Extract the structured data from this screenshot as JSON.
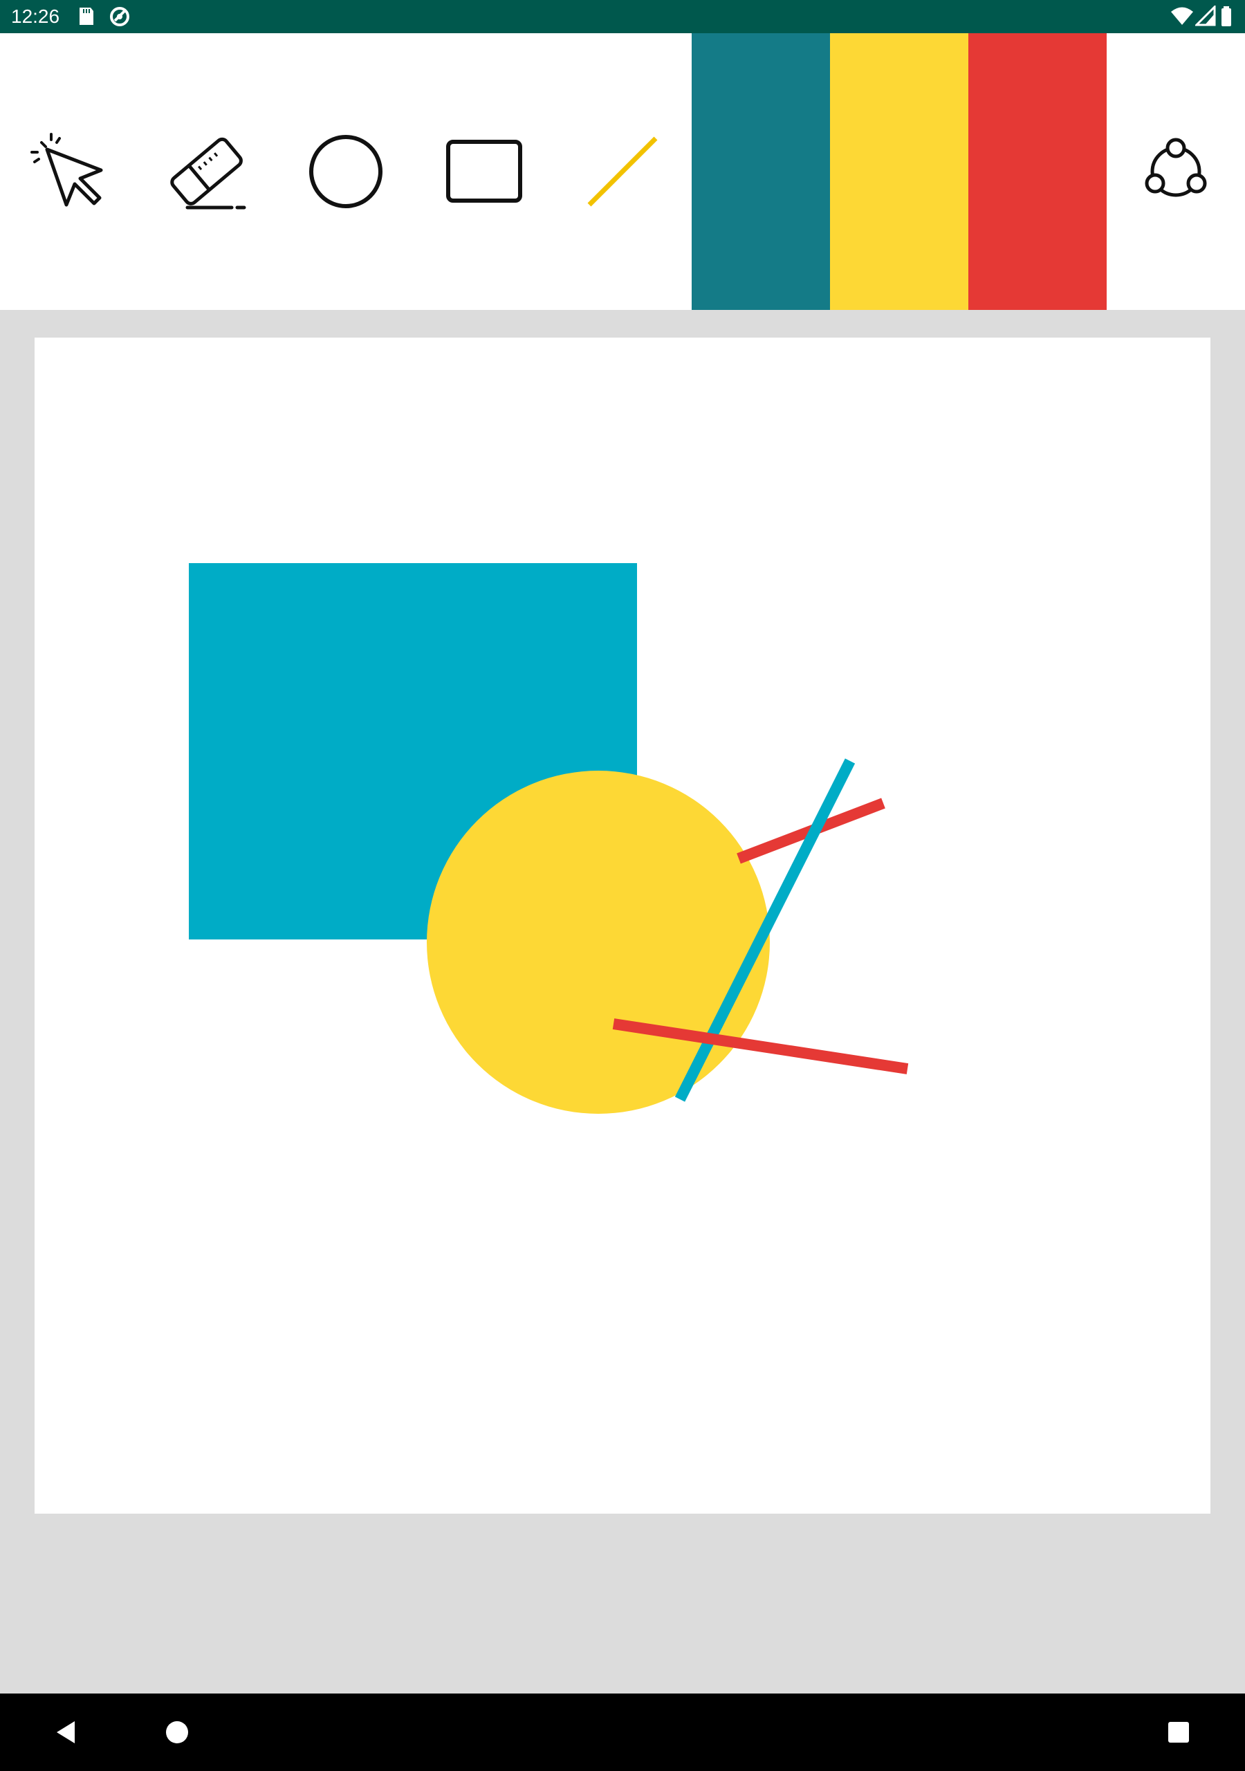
{
  "status_bar": {
    "time": "12:26",
    "background": "#00584d",
    "left_icons": [
      "sd-card-icon",
      "sync-icon"
    ],
    "right_icons": [
      "wifi-icon",
      "cellular-signal-icon",
      "battery-icon"
    ]
  },
  "toolbar": {
    "tools": [
      {
        "name": "select",
        "icon": "cursor-select-icon"
      },
      {
        "name": "eraser",
        "icon": "eraser-icon"
      },
      {
        "name": "circle",
        "icon": "circle-icon"
      },
      {
        "name": "rectangle",
        "icon": "rectangle-icon"
      },
      {
        "name": "line",
        "icon": "line-icon",
        "icon_color": "#f2c200"
      }
    ],
    "colors": [
      {
        "name": "teal",
        "hex": "#147b87"
      },
      {
        "name": "yellow",
        "hex": "#fdd835"
      },
      {
        "name": "red",
        "hex": "#e53935"
      }
    ],
    "share_icon": "share-icon"
  },
  "canvas": {
    "background": "#ffffff",
    "shapes": [
      {
        "type": "rectangle",
        "color": "#00acc6"
      },
      {
        "type": "circle",
        "color": "#fdd835"
      },
      {
        "type": "line",
        "color": "#e53935"
      },
      {
        "type": "line",
        "color": "#00acc6"
      },
      {
        "type": "line",
        "color": "#e53935"
      }
    ]
  },
  "nav_bar": {
    "buttons": [
      "back-icon",
      "home-icon",
      "recents-icon"
    ]
  }
}
